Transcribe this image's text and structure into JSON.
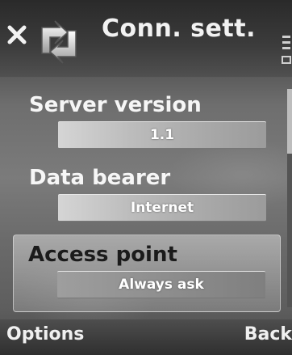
{
  "title_bar": {
    "title": "Conn. sett.",
    "close_icon": "close-icon",
    "app_icon": "sync-arrows-icon"
  },
  "settings": [
    {
      "label": "Server version",
      "value": "1.1",
      "selected": false
    },
    {
      "label": "Data bearer",
      "value": "Internet",
      "selected": false
    },
    {
      "label": "Access point",
      "value": "Always ask",
      "selected": true
    }
  ],
  "softkeys": {
    "left": "Options",
    "right": "Back"
  }
}
